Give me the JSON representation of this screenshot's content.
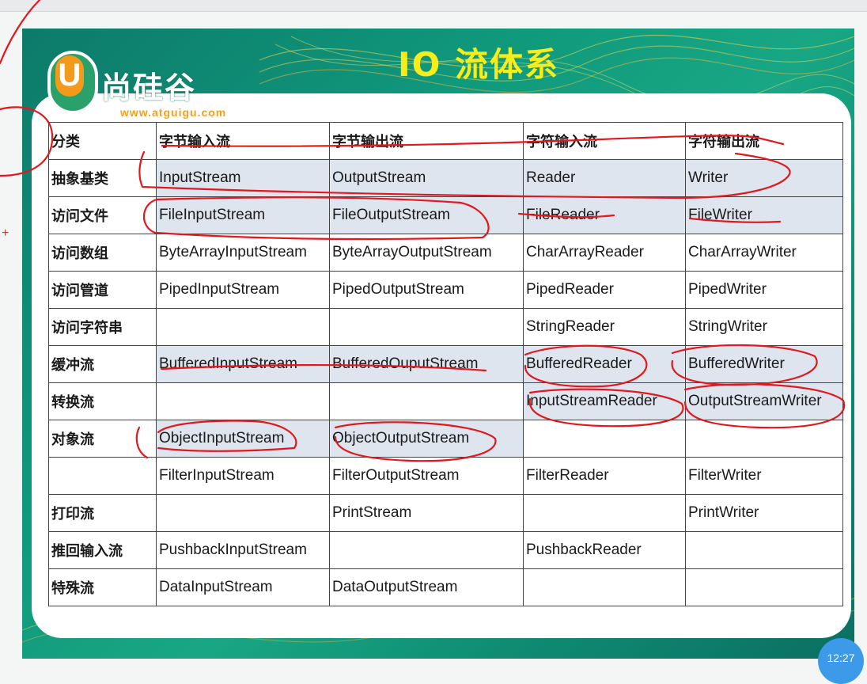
{
  "slide": {
    "title": "IO 流体系",
    "logo_name": "尚硅谷",
    "logo_letter": "U",
    "logo_url": "www.atguigu.com"
  },
  "table": {
    "header": [
      "分类",
      "字节输入流",
      "字节输出流",
      "字符输入流",
      "字符输出流"
    ],
    "rows": [
      [
        "抽象基类",
        "InputStream",
        "OutputStream",
        "Reader",
        "Writer"
      ],
      [
        "访问文件",
        "FileInputStream",
        "FileOutputStream",
        "FileReader",
        "FileWriter"
      ],
      [
        "访问数组",
        "ByteArrayInputStream",
        "ByteArrayOutputStream",
        "CharArrayReader",
        "CharArrayWriter"
      ],
      [
        "访问管道",
        "PipedInputStream",
        "PipedOutputStream",
        "PipedReader",
        "PipedWriter"
      ],
      [
        "访问字符串",
        "",
        "",
        "StringReader",
        "StringWriter"
      ],
      [
        "缓冲流",
        "BufferedInputStream",
        "BufferedOuputStream",
        "BufferedReader",
        "BufferedWriter"
      ],
      [
        "转换流",
        "",
        "",
        "InputStreamReader",
        "OutputStreamWriter"
      ],
      [
        "对象流",
        "ObjectInputStream",
        "ObjectOutputStream",
        "",
        ""
      ],
      [
        "",
        "FilterInputStream",
        "FilterOutputStream",
        "FilterReader",
        "FilterWriter"
      ],
      [
        "打印流",
        "",
        "PrintStream",
        "",
        "PrintWriter"
      ],
      [
        "推回输入流",
        "PushbackInputStream",
        "",
        "PushbackReader",
        ""
      ],
      [
        "特殊流",
        "DataInputStream",
        "DataOutputStream",
        "",
        ""
      ]
    ]
  },
  "overlay": {
    "clock": "12:27",
    "plus": "+"
  },
  "colors": {
    "annotation": "#e0191e",
    "title": "#f7ed1a",
    "highlight": "#dfe5ee"
  }
}
